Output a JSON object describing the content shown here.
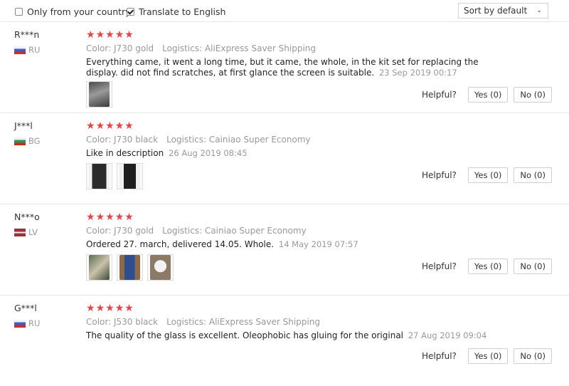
{
  "filters": {
    "only_country_label": "Only from your country",
    "only_country_checked": false,
    "translate_label": "Translate to English",
    "translate_checked": true
  },
  "sort": {
    "selected": "Sort by default"
  },
  "helpful_label": "Helpful?",
  "reviews": [
    {
      "user": "R***n",
      "country": "RU",
      "stars": 5,
      "color": "Color: J730 gold",
      "logistics": "Logistics: AliExpress Saver Shipping",
      "text": "Everything came, it went a long time, but it came, the whole, in the kit set for replacing the display. did not find scratches, at first glance the screen is suitable.",
      "date": "23 Sep 2019 00:17",
      "yes": "Yes (0)",
      "no": "No (0)"
    },
    {
      "user": "J***l",
      "country": "BG",
      "stars": 5,
      "color": "Color: J730 black",
      "logistics": "Logistics: Cainiao Super Economy",
      "text": "Like in description",
      "date": "26 Aug 2019 08:45",
      "yes": "Yes (0)",
      "no": "No (0)"
    },
    {
      "user": "N***o",
      "country": "LV",
      "stars": 5,
      "color": "Color: J730 gold",
      "logistics": "Logistics: Cainiao Super Economy",
      "text": "Ordered 27. march, delivered 14.05. Whole.",
      "date": "14 May 2019 07:57",
      "yes": "Yes (0)",
      "no": "No (0)"
    },
    {
      "user": "G***l",
      "country": "RU",
      "stars": 5,
      "color": "Color: J530 black",
      "logistics": "Logistics: AliExpress Saver Shipping",
      "text": "The quality of the glass is excellent. Oleophobic has gluing for the original",
      "date": "27 Aug 2019 09:04",
      "yes": "Yes (0)",
      "no": "No (0)"
    }
  ],
  "colors": {
    "star": "#e64545",
    "muted": "#999999",
    "border": "#e8e8e8"
  }
}
